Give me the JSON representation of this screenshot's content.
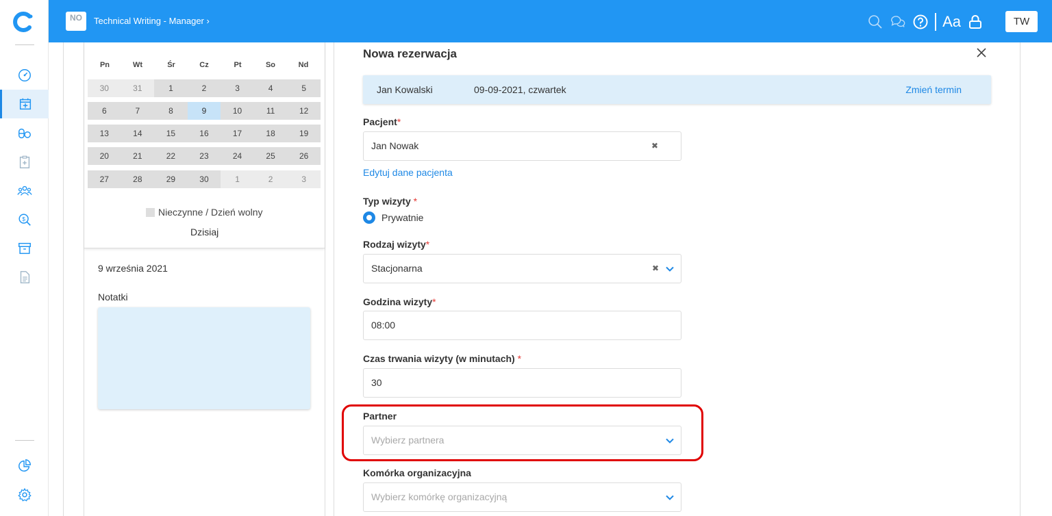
{
  "topbar": {
    "org_badge": "NO",
    "title": "Technical Writing - Manager ›",
    "font_toggle": "Aa",
    "avatar": "TW"
  },
  "sidebar": {
    "items": [
      {
        "icon": "speedometer-icon",
        "active": false
      },
      {
        "icon": "calendar-add-icon",
        "active": true
      },
      {
        "icon": "pills-icon",
        "active": false
      },
      {
        "icon": "clipboard-medical-icon",
        "active": false
      },
      {
        "icon": "people-icon",
        "active": false
      },
      {
        "icon": "search-money-icon",
        "active": false
      },
      {
        "icon": "archive-icon",
        "active": false
      },
      {
        "icon": "document-icon",
        "active": false
      },
      {
        "icon": "pie-chart-icon",
        "active": false
      },
      {
        "icon": "gear-icon",
        "active": false
      }
    ]
  },
  "calendar": {
    "weekdays": [
      "Pn",
      "Wt",
      "Śr",
      "Cz",
      "Pt",
      "So",
      "Nd"
    ],
    "weeks": [
      [
        "30",
        "31",
        "1",
        "2",
        "3",
        "4",
        "5"
      ],
      [
        "6",
        "7",
        "8",
        "9",
        "10",
        "11",
        "12"
      ],
      [
        "13",
        "14",
        "15",
        "16",
        "17",
        "18",
        "19"
      ],
      [
        "20",
        "21",
        "22",
        "23",
        "24",
        "25",
        "26"
      ],
      [
        "27",
        "28",
        "29",
        "30",
        "1",
        "2",
        "3"
      ]
    ],
    "legend": "Nieczynne / Dzień wolny",
    "today_button": "Dzisiaj",
    "selected_date": "9 września 2021",
    "notes_label": "Notatki"
  },
  "form": {
    "title": "Nowa rezerwacja",
    "info": {
      "doctor": "Jan Kowalski",
      "date": "09-09-2021, czwartek",
      "change_link": "Zmień termin"
    },
    "patient_label": "Pacjent",
    "patient_value": "Jan Nowak",
    "edit_patient_link": "Edytuj dane pacjenta",
    "visit_type_label": "Typ wizyty",
    "visit_type_option": "Prywatnie",
    "visit_kind_label": "Rodzaj wizyty",
    "visit_kind_value": "Stacjonarna",
    "hour_label": "Godzina wizyty",
    "hour_value": "08:00",
    "duration_label": "Czas trwania wizyty (w minutach)",
    "duration_value": "30",
    "partner_label": "Partner",
    "partner_placeholder": "Wybierz partnera",
    "org_unit_label": "Komórka organizacyjna",
    "org_unit_placeholder": "Wybierz komórkę organizacyjną",
    "required_mark": "*",
    "clear_symbol": "✖"
  },
  "colors": {
    "primary": "#2196f3",
    "link": "#1e88e5",
    "required": "#e53935",
    "highlight": "#e00000"
  }
}
